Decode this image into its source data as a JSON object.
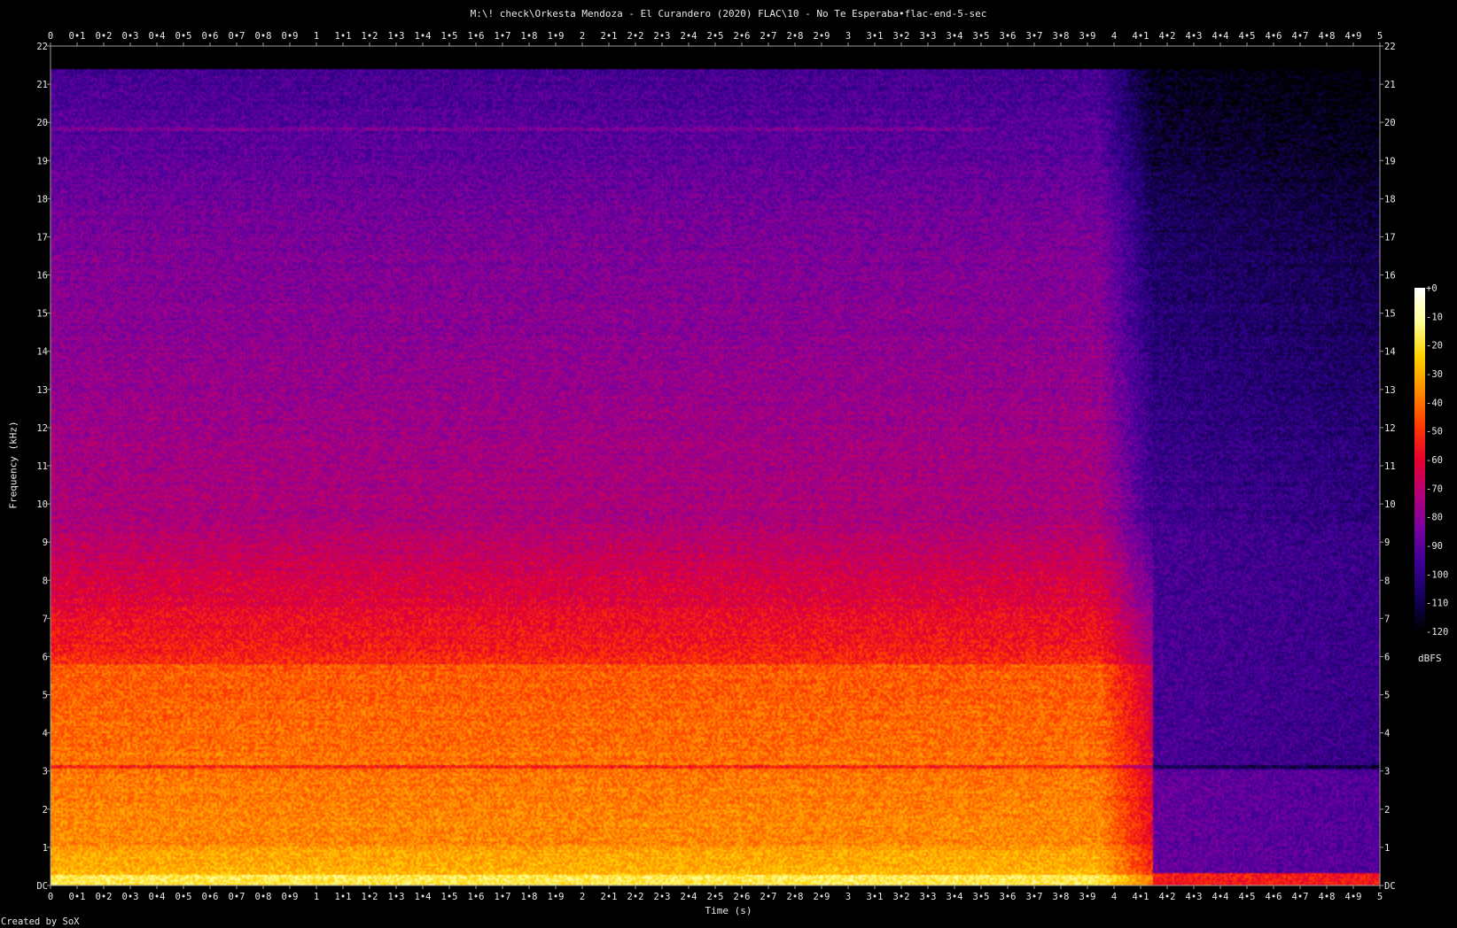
{
  "title": "M:\\! check\\Orkesta Mendoza - El Curandero (2020) FLAC\\10 - No Te Esperaba•flac-end-5-sec",
  "footer": "Created by SoX",
  "colors": {
    "background": "#000000",
    "text": "#e8e8e8",
    "palette": [
      "#000000",
      "#14005a",
      "#3c0096",
      "#7800a0",
      "#b40078",
      "#e6002d",
      "#ff3c00",
      "#ff8c00",
      "#ffd200",
      "#ffff96",
      "#ffffff"
    ]
  },
  "chart_data": {
    "type": "heatmap",
    "title": "M:\\! check\\Orkesta Mendoza - El Curandero (2020) FLAC\\10 - No Te Esperaba•flac-end-5-sec",
    "xlabel": "Time (s)",
    "ylabel": "Frequency (kHz)",
    "xlim": [
      0,
      5
    ],
    "ylim": [
      0,
      22
    ],
    "x_ticks": [
      "0",
      "0•1",
      "0•2",
      "0•3",
      "0•4",
      "0•5",
      "0•6",
      "0•7",
      "0•8",
      "0•9",
      "1",
      "1•1",
      "1•2",
      "1•3",
      "1•4",
      "1•5",
      "1•6",
      "1•7",
      "1•8",
      "1•9",
      "2",
      "2•1",
      "2•2",
      "2•3",
      "2•4",
      "2•5",
      "2•6",
      "2•7",
      "2•8",
      "2•9",
      "3",
      "3•1",
      "3•2",
      "3•3",
      "3•4",
      "3•5",
      "3•6",
      "3•7",
      "3•8",
      "3•9",
      "4",
      "4•1",
      "4•2",
      "4•3",
      "4•4",
      "4•5",
      "4•6",
      "4•7",
      "4•8",
      "4•9",
      "5"
    ],
    "y_ticks": [
      "DC",
      "1",
      "2",
      "3",
      "4",
      "5",
      "6",
      "7",
      "8",
      "9",
      "10",
      "11",
      "12",
      "13",
      "14",
      "15",
      "16",
      "17",
      "18",
      "19",
      "20",
      "21",
      "22"
    ],
    "colorbar": {
      "unit": "dBFS",
      "range": [
        -120,
        0
      ],
      "ticks": [
        "+0",
        "-10",
        "-20",
        "-30",
        "-40",
        "-50",
        "-60",
        "-70",
        "-80",
        "-90",
        "-100",
        "-110",
        "-120"
      ]
    },
    "signal": {
      "music_end_time_s": 3.95,
      "decay_end_time_s": 4.15,
      "upper_limit_khz": 21.4,
      "band_line_khz": 3.1
    }
  }
}
